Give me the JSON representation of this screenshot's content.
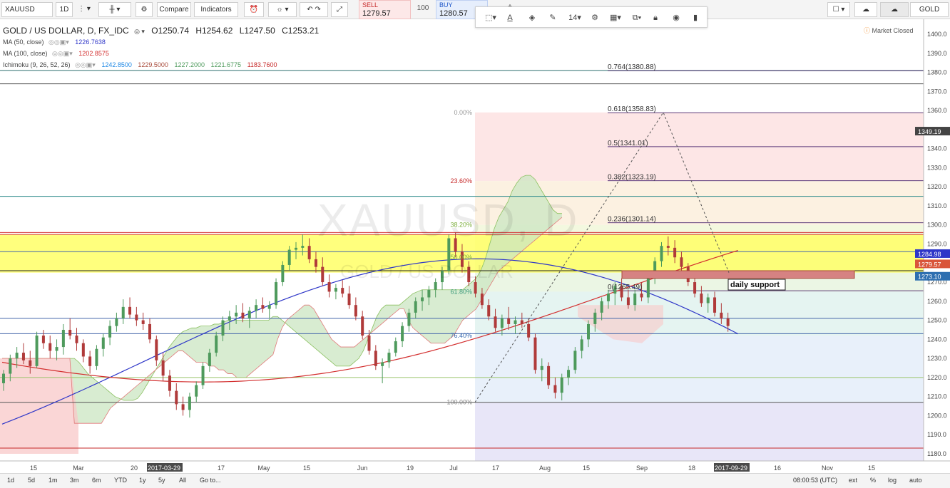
{
  "toolbar": {
    "symbol": "XAUUSD",
    "interval": "1D",
    "compare": "Compare",
    "indicators": "Indicators",
    "sell_label": "SELL",
    "sell_price": "1279.57",
    "spread": "100",
    "buy_label": "BUY",
    "buy_price": "1280.57",
    "plus": "+",
    "right_symbol": "GOLD"
  },
  "drawbar": {
    "font_size": "14"
  },
  "legend": {
    "title": "GOLD / US DOLLAR, D, FX_IDC",
    "open": "O1250.74",
    "high": "H1254.62",
    "low": "L1247.50",
    "close": "C1253.21",
    "ma50": {
      "label": "MA (50, close)",
      "value": "1226.7638"
    },
    "ma100": {
      "label": "MA (100, close)",
      "value": "1202.8575"
    },
    "ichimoku": {
      "label": "Ichimoku (9, 26, 52, 26)",
      "values": [
        "1242.8500",
        "1229.5000",
        "1227.2000",
        "1221.6775",
        "1183.7600"
      ]
    }
  },
  "market_status": "Market Closed",
  "watermark": {
    "main": "XAUUSD, D",
    "sub": "GOLD / US DOLLAR"
  },
  "bottombar": {
    "ranges": [
      "1d",
      "5d",
      "1m",
      "3m",
      "6m",
      "YTD",
      "1y",
      "5y",
      "All",
      "Go to..."
    ],
    "time": "08:00:53 (UTC)",
    "ext": "ext",
    "pct": "%",
    "log": "log",
    "auto": "auto"
  },
  "colors": {
    "bull": "#4e9a5c",
    "bear": "#b03a3a",
    "ma50": "#2e36c8",
    "ma100": "#d32f2f",
    "tenkan": "#4aa8e8",
    "kijun": "#a84a3a",
    "chikou": "#8bc060",
    "cloud_green": "#cbe6c2",
    "cloud_red": "#f8c8c8",
    "yellow_zone": "#ffff66",
    "support": "#d68282"
  },
  "chart_data": {
    "type": "candlestick",
    "title": "GOLD / US DOLLAR, D, FX_IDC",
    "ylim": [
      1175,
      1405
    ],
    "y_ticks": [
      1180,
      1190,
      1200,
      1210,
      1220,
      1230,
      1240,
      1250,
      1260,
      1270,
      1280,
      1290,
      1300,
      1310,
      1320,
      1330,
      1340,
      1350,
      1360,
      1370,
      1380,
      1390,
      1400
    ],
    "x_labels": [
      "15",
      "Mar",
      "20",
      "2017-03-29",
      "17",
      "May",
      "15",
      "Jun",
      "19",
      "Jul",
      "17",
      "Aug",
      "15",
      "Sep",
      "18",
      "2017-09-29",
      "16",
      "Nov",
      "15"
    ],
    "price_labels": [
      {
        "value": "1349.19"
      },
      {
        "value": "1284.98"
      },
      {
        "value": "1279.57"
      },
      {
        "value": "1273.10"
      }
    ],
    "fib_retracement": [
      {
        "label": "0.00%",
        "price": 1359
      },
      {
        "label": "23.60%",
        "price": 1323
      },
      {
        "label": "38.20%",
        "price": 1300
      },
      {
        "label": "50.00%",
        "price": 1283
      },
      {
        "label": "61.80%",
        "price": 1265
      },
      {
        "label": "76.40%",
        "price": 1242
      },
      {
        "label": "100.00%",
        "price": 1207
      }
    ],
    "fib_extension": [
      {
        "label": "0.764(1380.88)",
        "price": 1380.88
      },
      {
        "label": "0.618(1358.83)",
        "price": 1358.83
      },
      {
        "label": "0.5(1341.01)",
        "price": 1341.01
      },
      {
        "label": "0.382(1323.19)",
        "price": 1323.19
      },
      {
        "label": "0.236(1301.14)",
        "price": 1301.14
      },
      {
        "label": "0(1265.49)",
        "price": 1265.49
      }
    ],
    "resistance_zone": [
      1275,
      1295
    ],
    "support_zone": [
      1272,
      1276
    ],
    "support_label": "daily support",
    "horizontal_levels": [
      1381,
      1374,
      1315,
      1296,
      1295,
      1286,
      1276,
      1251,
      1243,
      1220,
      1207,
      1183
    ],
    "candles": [
      [
        1217,
        1224,
        1213,
        1222
      ],
      [
        1222,
        1232,
        1218,
        1230
      ],
      [
        1230,
        1236,
        1225,
        1233
      ],
      [
        1233,
        1238,
        1227,
        1229
      ],
      [
        1229,
        1234,
        1222,
        1226
      ],
      [
        1226,
        1244,
        1225,
        1242
      ],
      [
        1242,
        1245,
        1235,
        1238
      ],
      [
        1238,
        1242,
        1230,
        1234
      ],
      [
        1234,
        1240,
        1229,
        1236
      ],
      [
        1236,
        1248,
        1232,
        1245
      ],
      [
        1245,
        1251,
        1240,
        1242
      ],
      [
        1242,
        1246,
        1234,
        1238
      ],
      [
        1238,
        1240,
        1228,
        1231
      ],
      [
        1231,
        1234,
        1222,
        1226
      ],
      [
        1226,
        1237,
        1224,
        1235
      ],
      [
        1235,
        1243,
        1231,
        1241
      ],
      [
        1241,
        1250,
        1237,
        1247
      ],
      [
        1247,
        1254,
        1244,
        1251
      ],
      [
        1251,
        1261,
        1248,
        1257
      ],
      [
        1257,
        1262,
        1251,
        1253
      ],
      [
        1253,
        1257,
        1247,
        1250
      ],
      [
        1250,
        1254,
        1245,
        1248
      ],
      [
        1248,
        1251,
        1238,
        1240
      ],
      [
        1240,
        1242,
        1226,
        1229
      ],
      [
        1229,
        1233,
        1218,
        1221
      ],
      [
        1221,
        1224,
        1210,
        1213
      ],
      [
        1213,
        1217,
        1203,
        1206
      ],
      [
        1206,
        1210,
        1200,
        1203
      ],
      [
        1203,
        1212,
        1199,
        1210
      ],
      [
        1210,
        1218,
        1207,
        1216
      ],
      [
        1216,
        1228,
        1214,
        1226
      ],
      [
        1226,
        1235,
        1223,
        1233
      ],
      [
        1233,
        1244,
        1231,
        1242
      ],
      [
        1242,
        1252,
        1239,
        1250
      ],
      [
        1250,
        1255,
        1245,
        1252
      ],
      [
        1252,
        1258,
        1248,
        1254
      ],
      [
        1254,
        1259,
        1249,
        1251
      ],
      [
        1251,
        1257,
        1246,
        1255
      ],
      [
        1255,
        1261,
        1251,
        1258
      ],
      [
        1258,
        1262,
        1254,
        1256
      ],
      [
        1256,
        1260,
        1251,
        1258
      ],
      [
        1258,
        1272,
        1256,
        1270
      ],
      [
        1270,
        1281,
        1268,
        1279
      ],
      [
        1279,
        1289,
        1276,
        1287
      ],
      [
        1287,
        1291,
        1282,
        1288
      ],
      [
        1288,
        1295,
        1284,
        1289
      ],
      [
        1289,
        1293,
        1280,
        1282
      ],
      [
        1282,
        1286,
        1275,
        1278
      ],
      [
        1278,
        1283,
        1268,
        1270
      ],
      [
        1270,
        1274,
        1262,
        1265
      ],
      [
        1265,
        1269,
        1261,
        1267
      ],
      [
        1267,
        1271,
        1262,
        1264
      ],
      [
        1264,
        1268,
        1256,
        1258
      ],
      [
        1258,
        1262,
        1250,
        1252
      ],
      [
        1252,
        1255,
        1240,
        1242
      ],
      [
        1242,
        1245,
        1232,
        1234
      ],
      [
        1234,
        1237,
        1224,
        1226
      ],
      [
        1226,
        1230,
        1217,
        1228
      ],
      [
        1228,
        1235,
        1225,
        1233
      ],
      [
        1233,
        1241,
        1231,
        1239
      ],
      [
        1239,
        1249,
        1236,
        1247
      ],
      [
        1247,
        1256,
        1244,
        1254
      ],
      [
        1254,
        1262,
        1251,
        1260
      ],
      [
        1260,
        1266,
        1255,
        1262
      ],
      [
        1262,
        1268,
        1258,
        1266
      ],
      [
        1266,
        1272,
        1262,
        1270
      ],
      [
        1270,
        1278,
        1266,
        1276
      ],
      [
        1276,
        1295,
        1274,
        1293
      ],
      [
        1293,
        1296,
        1283,
        1286
      ],
      [
        1286,
        1290,
        1275,
        1278
      ],
      [
        1278,
        1281,
        1268,
        1270
      ],
      [
        1270,
        1273,
        1262,
        1264
      ],
      [
        1264,
        1267,
        1256,
        1258
      ],
      [
        1258,
        1261,
        1250,
        1252
      ],
      [
        1252,
        1256,
        1244,
        1246
      ],
      [
        1246,
        1253,
        1242,
        1251
      ],
      [
        1251,
        1257,
        1245,
        1248
      ],
      [
        1248,
        1252,
        1243,
        1250
      ],
      [
        1250,
        1254,
        1246,
        1248
      ],
      [
        1248,
        1251,
        1239,
        1241
      ],
      [
        1241,
        1243,
        1222,
        1224
      ],
      [
        1224,
        1230,
        1218,
        1226
      ],
      [
        1226,
        1228,
        1214,
        1216
      ],
      [
        1216,
        1220,
        1209,
        1212
      ],
      [
        1212,
        1222,
        1208,
        1220
      ],
      [
        1220,
        1226,
        1216,
        1224
      ],
      [
        1224,
        1236,
        1222,
        1234
      ],
      [
        1234,
        1242,
        1230,
        1240
      ],
      [
        1240,
        1250,
        1236,
        1248
      ],
      [
        1248,
        1256,
        1244,
        1254
      ],
      [
        1254,
        1262,
        1250,
        1260
      ],
      [
        1260,
        1266,
        1256,
        1264
      ],
      [
        1264,
        1270,
        1258,
        1268
      ],
      [
        1268,
        1272,
        1260,
        1262
      ],
      [
        1262,
        1266,
        1256,
        1258
      ],
      [
        1258,
        1266,
        1255,
        1264
      ],
      [
        1264,
        1270,
        1260,
        1262
      ],
      [
        1262,
        1274,
        1259,
        1272
      ],
      [
        1272,
        1283,
        1269,
        1281
      ],
      [
        1281,
        1291,
        1278,
        1289
      ],
      [
        1289,
        1294,
        1284,
        1288
      ],
      [
        1288,
        1292,
        1280,
        1283
      ],
      [
        1283,
        1286,
        1276,
        1278
      ],
      [
        1278,
        1280,
        1268,
        1270
      ],
      [
        1270,
        1274,
        1262,
        1264
      ],
      [
        1264,
        1268,
        1257,
        1259
      ],
      [
        1259,
        1264,
        1254,
        1262
      ],
      [
        1262,
        1265,
        1252,
        1254
      ],
      [
        1254,
        1259,
        1248,
        1251
      ],
      [
        1251,
        1254,
        1244,
        1247
      ]
    ]
  }
}
